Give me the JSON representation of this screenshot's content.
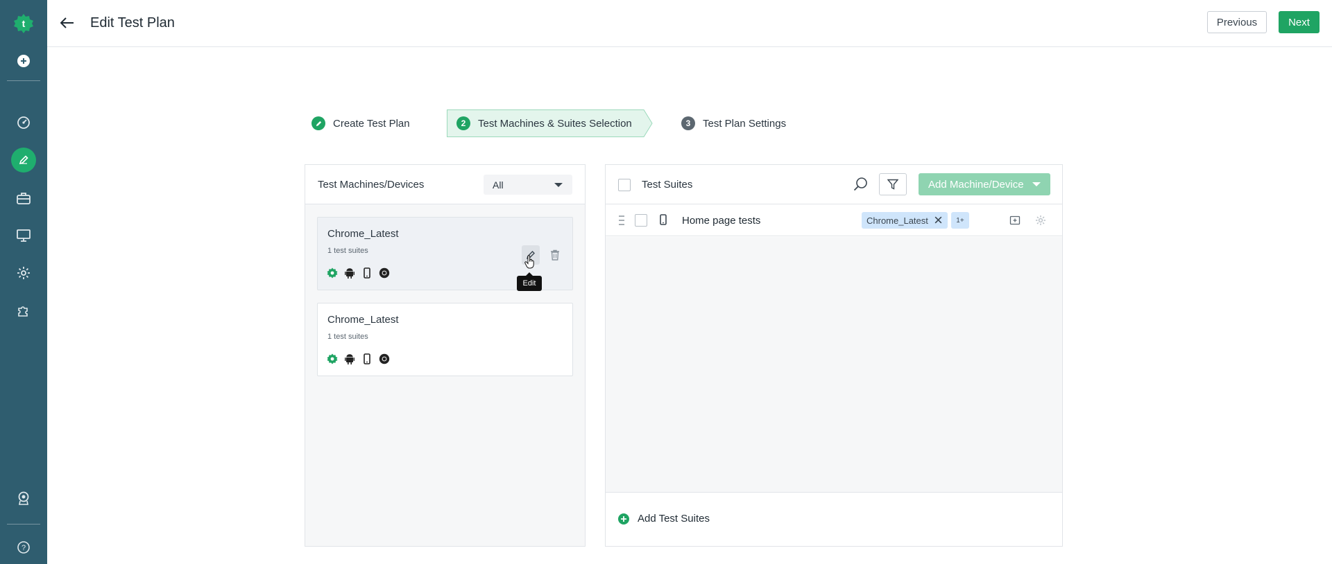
{
  "header": {
    "title": "Edit Test Plan",
    "previous_label": "Previous",
    "next_label": "Next"
  },
  "colors": {
    "sidebar": "#2f5d6f",
    "accent": "#1fa463",
    "chip": "#cfe5fb",
    "add_machine_disabled": "#8fd4b1"
  },
  "sidebar": {
    "items": [
      {
        "icon": "testsigma-logo-icon"
      },
      {
        "icon": "add-circle-icon"
      },
      {
        "icon": "dashboard-icon"
      },
      {
        "icon": "edit-pencil-icon",
        "active": true
      },
      {
        "icon": "briefcase-icon"
      },
      {
        "icon": "monitor-icon"
      },
      {
        "icon": "settings-icon"
      },
      {
        "icon": "puzzle-icon"
      },
      {
        "icon": "support-badge-icon"
      },
      {
        "icon": "help-icon"
      }
    ]
  },
  "stepper": {
    "steps": [
      {
        "number": "",
        "label": "Create Test Plan",
        "state": "done"
      },
      {
        "number": "2",
        "label": "Test Machines & Suites Selection",
        "state": "active"
      },
      {
        "number": "3",
        "label": "Test Plan Settings",
        "state": "upcoming"
      }
    ]
  },
  "machines_panel": {
    "title": "Test Machines/Devices",
    "filter_value": "All",
    "cards": [
      {
        "name": "Chrome_Latest",
        "subtitle": "1 test suites",
        "selected": true
      },
      {
        "name": "Chrome_Latest",
        "subtitle": "1 test suites",
        "selected": false
      }
    ],
    "card_icons": [
      "testsigma-icon",
      "android-icon",
      "mobile-icon",
      "chrome-icon"
    ],
    "tooltip": "Edit"
  },
  "suites_panel": {
    "title": "Test Suites",
    "add_machine_label": "Add Machine/Device",
    "rows": [
      {
        "name": "Home page tests",
        "chip": "Chrome_Latest",
        "more": "1+"
      }
    ],
    "add_suites_label": "Add Test Suites"
  }
}
